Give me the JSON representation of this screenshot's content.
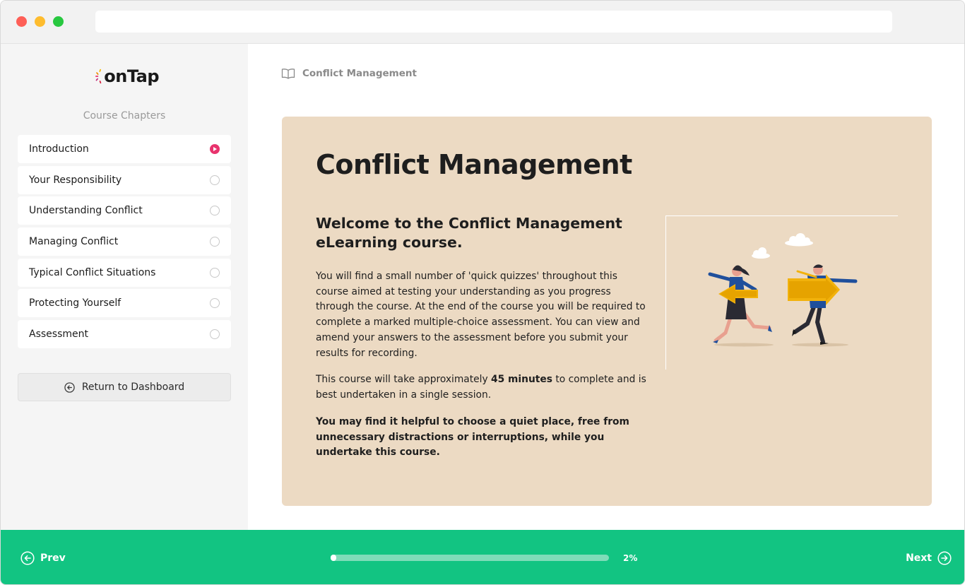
{
  "app": {
    "logo_text": "onTap"
  },
  "sidebar": {
    "heading": "Course Chapters",
    "chapters": [
      {
        "label": "Introduction",
        "status": "active"
      },
      {
        "label": "Your Responsibility",
        "status": "not-started"
      },
      {
        "label": "Understanding Conflict",
        "status": "not-started"
      },
      {
        "label": "Managing Conflict",
        "status": "not-started"
      },
      {
        "label": "Typical Conflict Situations",
        "status": "not-started"
      },
      {
        "label": "Protecting Yourself",
        "status": "not-started"
      },
      {
        "label": "Assessment",
        "status": "not-started"
      }
    ],
    "return_label": "Return to Dashboard"
  },
  "main": {
    "breadcrumb": "Conflict Management",
    "card": {
      "title": "Conflict Management",
      "subtitle": "Welcome to the Conflict Management eLearning course.",
      "paragraph1": "You will find a small number of 'quick quizzes' throughout this course aimed at testing your understanding as you progress through the course.  At the end of the course you will be required to complete a marked multiple-choice assessment. You can view and amend your answers to the assessment before you submit your results for recording.",
      "paragraph2_before": "This course will take approximately ",
      "paragraph2_bold": "45 minutes",
      "paragraph2_after": " to complete and is best undertaken in a single session.",
      "paragraph3": "You may find it helpful to choose a quiet place, free from unnecessary distractions or interruptions, while you undertake this course."
    }
  },
  "footer": {
    "prev_label": "Prev",
    "next_label": "Next",
    "progress_text": "2%",
    "progress_fraction": 0.02
  },
  "colors": {
    "accent_green": "#12c482",
    "card_bg": "#ecdac3",
    "active_pink": "#e8336d"
  }
}
